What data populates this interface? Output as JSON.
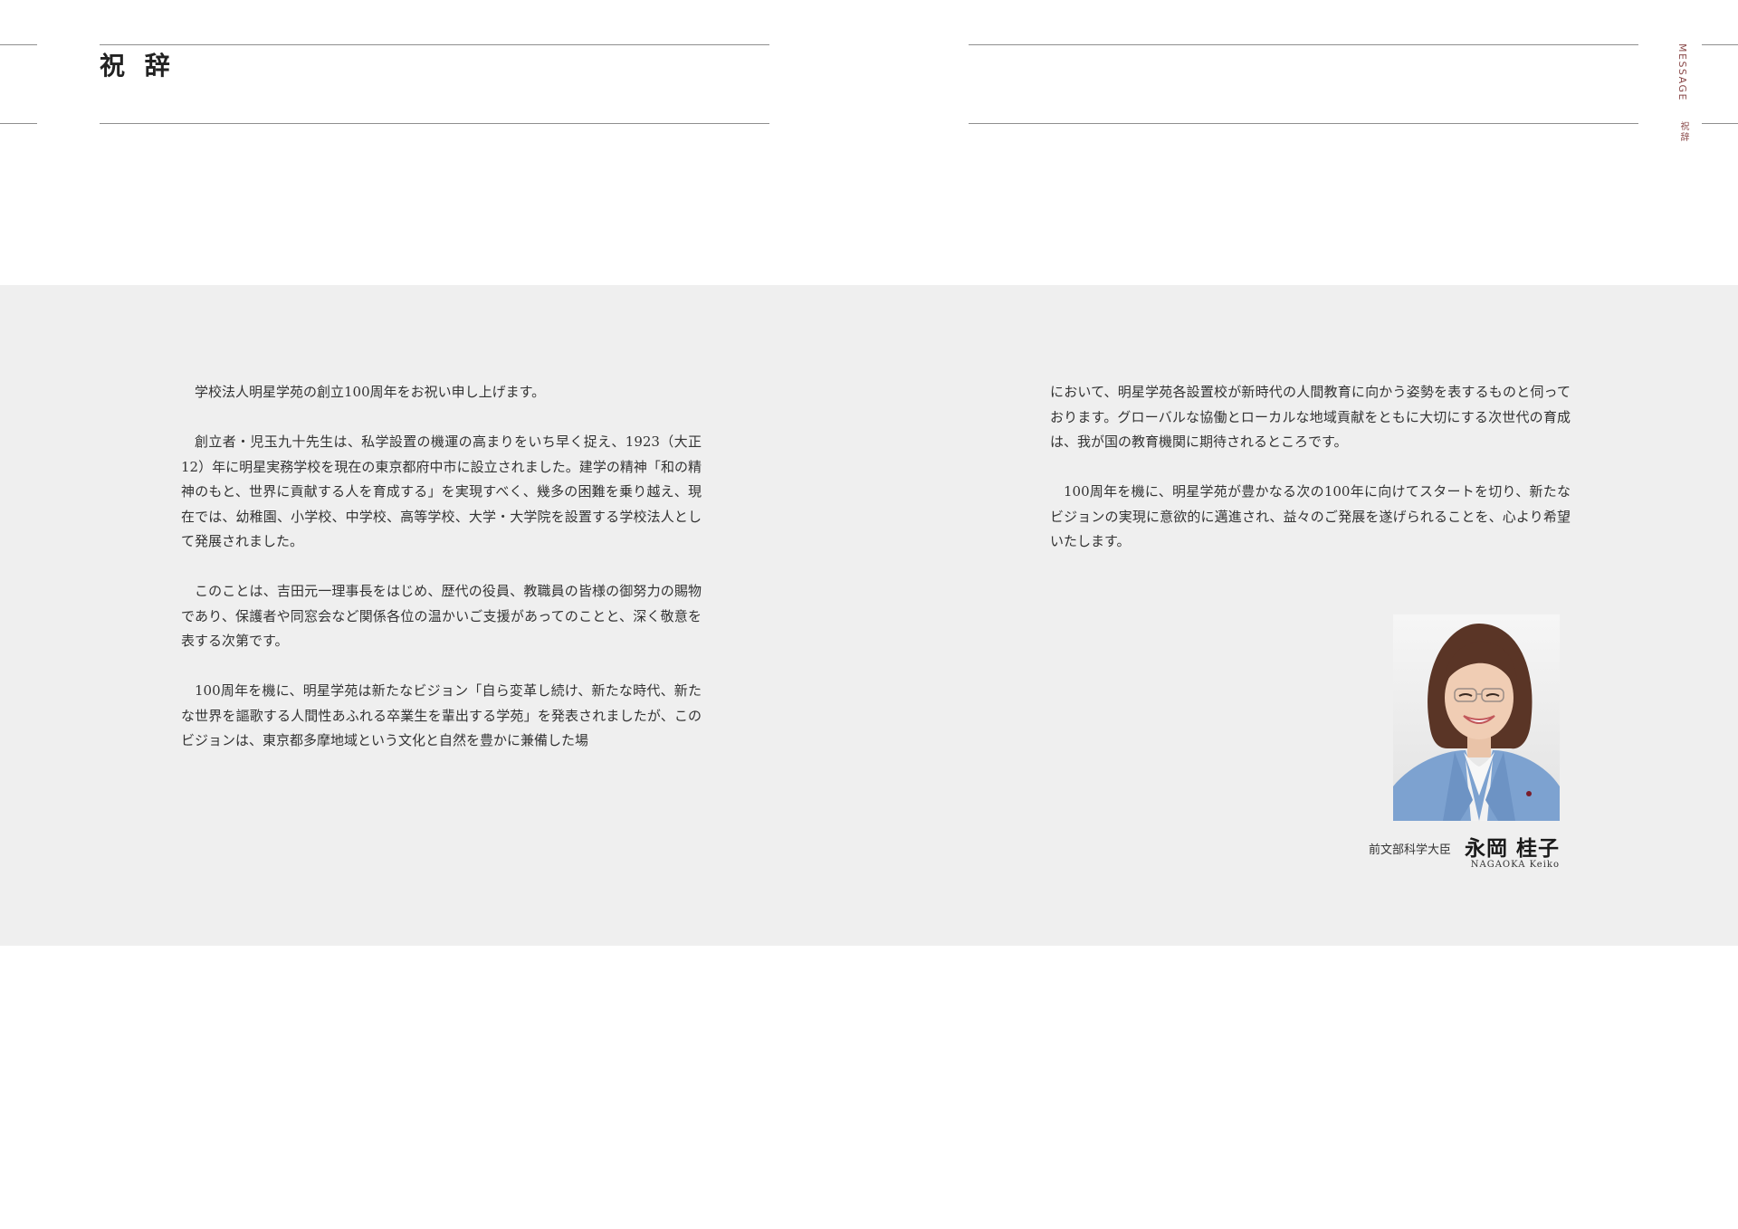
{
  "header": {
    "title": "祝 辞"
  },
  "side_tab": {
    "label_en": "MESSAGE",
    "label_jp": "祝辞"
  },
  "body": {
    "left_paragraphs": [
      "学校法人明星学苑の創立100周年をお祝い申し上げます。",
      "創立者・児玉九十先生は、私学設置の機運の高まりをいち早く捉え、1923（大正12）年に明星実務学校を現在の東京都府中市に設立されました。建学の精神「和の精神のもと、世界に貢献する人を育成する」を実現すべく、幾多の困難を乗り越え、現在では、幼稚園、小学校、中学校、高等学校、大学・大学院を設置する学校法人として発展されました。",
      "このことは、吉田元一理事長をはじめ、歴代の役員、教職員の皆様の御努力の賜物であり、保護者や同窓会など関係各位の温かいご支援があってのことと、深く敬意を表する次第です。",
      "100周年を機に、明星学苑は新たなビジョン「自ら変革し続け、新たな時代、新たな世界を謳歌する人間性あふれる卒業生を輩出する学苑」を発表されましたが、このビジョンは、東京都多摩地域という文化と自然を豊かに兼備した場"
    ],
    "right_paragraphs": [
      "において、明星学苑各設置校が新時代の人間教育に向かう姿勢を表するものと伺っております。グローバルな協働とローカルな地域貢献をともに大切にする次世代の育成は、我が国の教育機関に期待されるところです。",
      "100周年を機に、明星学苑が豊かなる次の100年に向けてスタートを切り、新たなビジョンの実現に意欲的に邁進され、益々のご発展を遂げられることを、心より希望いたします。"
    ]
  },
  "signature": {
    "title": "前文部科学大臣",
    "name": "永岡 桂子",
    "romaji": "NAGAOKA Keiko"
  },
  "colors": {
    "band": "#efefef",
    "accent": "#8a4a4a",
    "rule": "#8f8f8f"
  }
}
